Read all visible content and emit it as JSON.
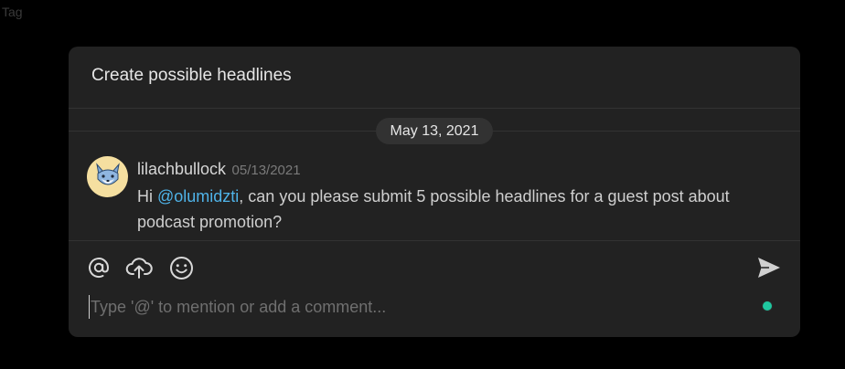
{
  "page": {
    "corner_tag": "Tag"
  },
  "panel": {
    "title": "Create possible headlines",
    "date_divider": "May 13, 2021"
  },
  "comment": {
    "author": "lilachbullock",
    "timestamp": "05/13/2021",
    "text_before": "Hi ",
    "mention": "@olumidzti",
    "text_after": ", can you please submit 5 possible headlines for a guest post about podcast promotion?"
  },
  "composer": {
    "tools": [
      "at-mention-icon",
      "upload-cloud-icon",
      "emoji-icon"
    ],
    "send_icon": "send-icon",
    "placeholder": "Type '@' to mention or add a comment...",
    "value": "",
    "status_color": "#1fc8a0"
  },
  "colors": {
    "background": "#000000",
    "panel": "#222222",
    "mention": "#4fb3e8"
  }
}
